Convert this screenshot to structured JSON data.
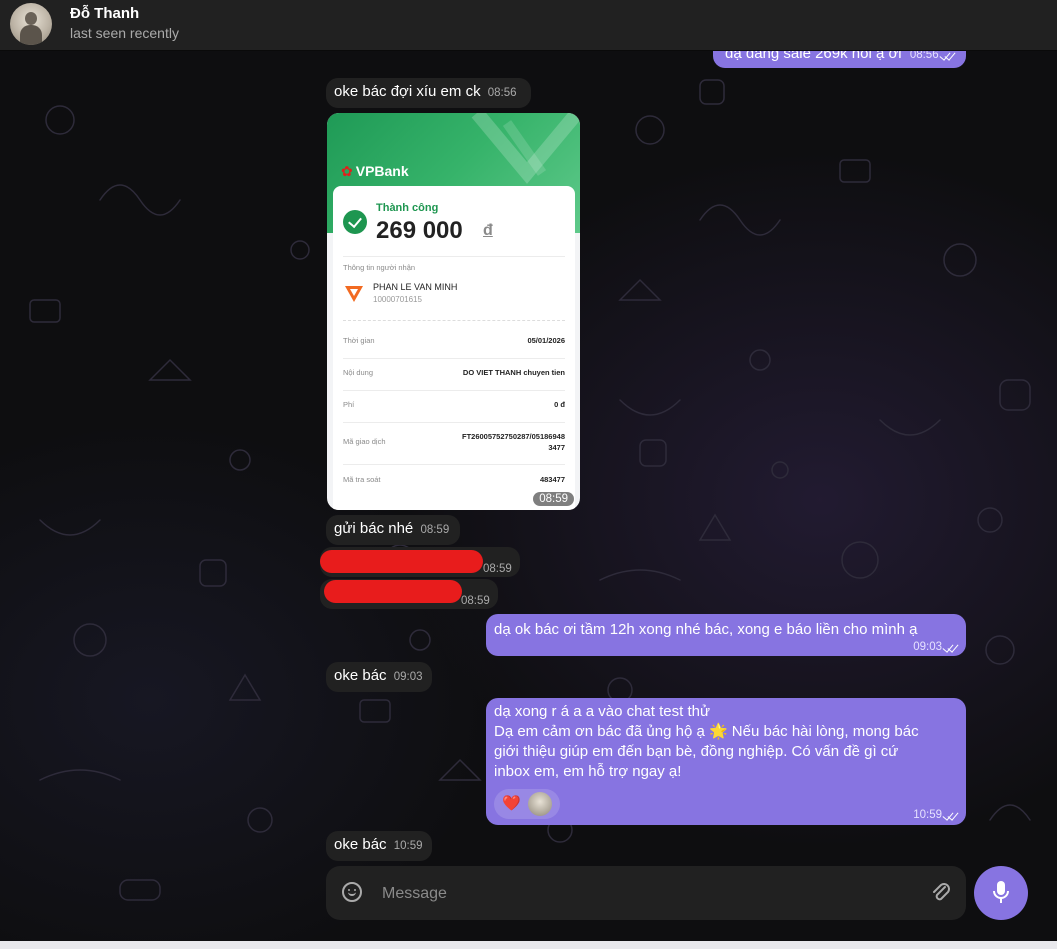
{
  "header": {
    "contact_name": "Đỗ Thanh",
    "status": "last seen recently"
  },
  "messages": [
    {
      "dir": "out",
      "text": "dạ đang sale 269k nôi ạ ơi",
      "time": "08:56",
      "read": true
    },
    {
      "dir": "in",
      "text": "oke bác đợi xíu em ck",
      "time": "08:56"
    },
    {
      "dir": "in",
      "type": "image",
      "time": "08:59"
    },
    {
      "dir": "in",
      "text": "gửi bác nhé",
      "time": "08:59"
    },
    {
      "dir": "in",
      "type": "redacted",
      "time": "08:59"
    },
    {
      "dir": "in",
      "type": "redacted",
      "time": "08:59"
    },
    {
      "dir": "out",
      "text": "dạ ok bác ơi tầm 12h xong nhé bác, xong e báo liền cho mình ạ",
      "time": "09:03",
      "read": true
    },
    {
      "dir": "in",
      "text": "oke bác",
      "time": "09:03"
    },
    {
      "dir": "out",
      "text_lines": [
        "dạ xong r á a a vào chat test thử",
        "Dạ em cảm ơn bác đã ủng hộ ạ 🌟 Nếu bác hài lòng, mong bác",
        "giới thiệu giúp em đến bạn bè, đồng nghiệp. Có vấn đề gì cứ",
        "inbox em, em hỗ trợ ngay ạ!"
      ],
      "time": "10:59",
      "read": true,
      "reaction": "❤️"
    },
    {
      "dir": "in",
      "text": "oke bác",
      "time": "10:59"
    }
  ],
  "receipt": {
    "bank": "VPBank",
    "status": "Thành công",
    "amount": "269 000",
    "currency": "đ",
    "recipient_label": "Thông tin người nhận",
    "recipient_name": "PHAN LE VAN MINH",
    "recipient_account": "10000701615",
    "rows": [
      {
        "label": "Thời gian",
        "value": "05/01/2026"
      },
      {
        "label": "Nội dung",
        "value": "DO VIET THANH chuyen tien"
      },
      {
        "label": "Phí",
        "value": "0 đ"
      },
      {
        "label": "Mã giao dịch",
        "value": "FT26005752750287/05186948",
        "value2": "3477"
      },
      {
        "label": "Mã tra soát",
        "value": "483477"
      }
    ]
  },
  "composer": {
    "placeholder": "Message",
    "emoji_icon": "smile-icon",
    "attach_icon": "paperclip-icon",
    "send_icon": "microphone-icon"
  },
  "colors": {
    "outgoing_bubble": "#8774e1",
    "incoming_bubble": "#212121",
    "header": "#212121",
    "redaction": "#e81c1c",
    "bank_green": "#1e9650"
  }
}
